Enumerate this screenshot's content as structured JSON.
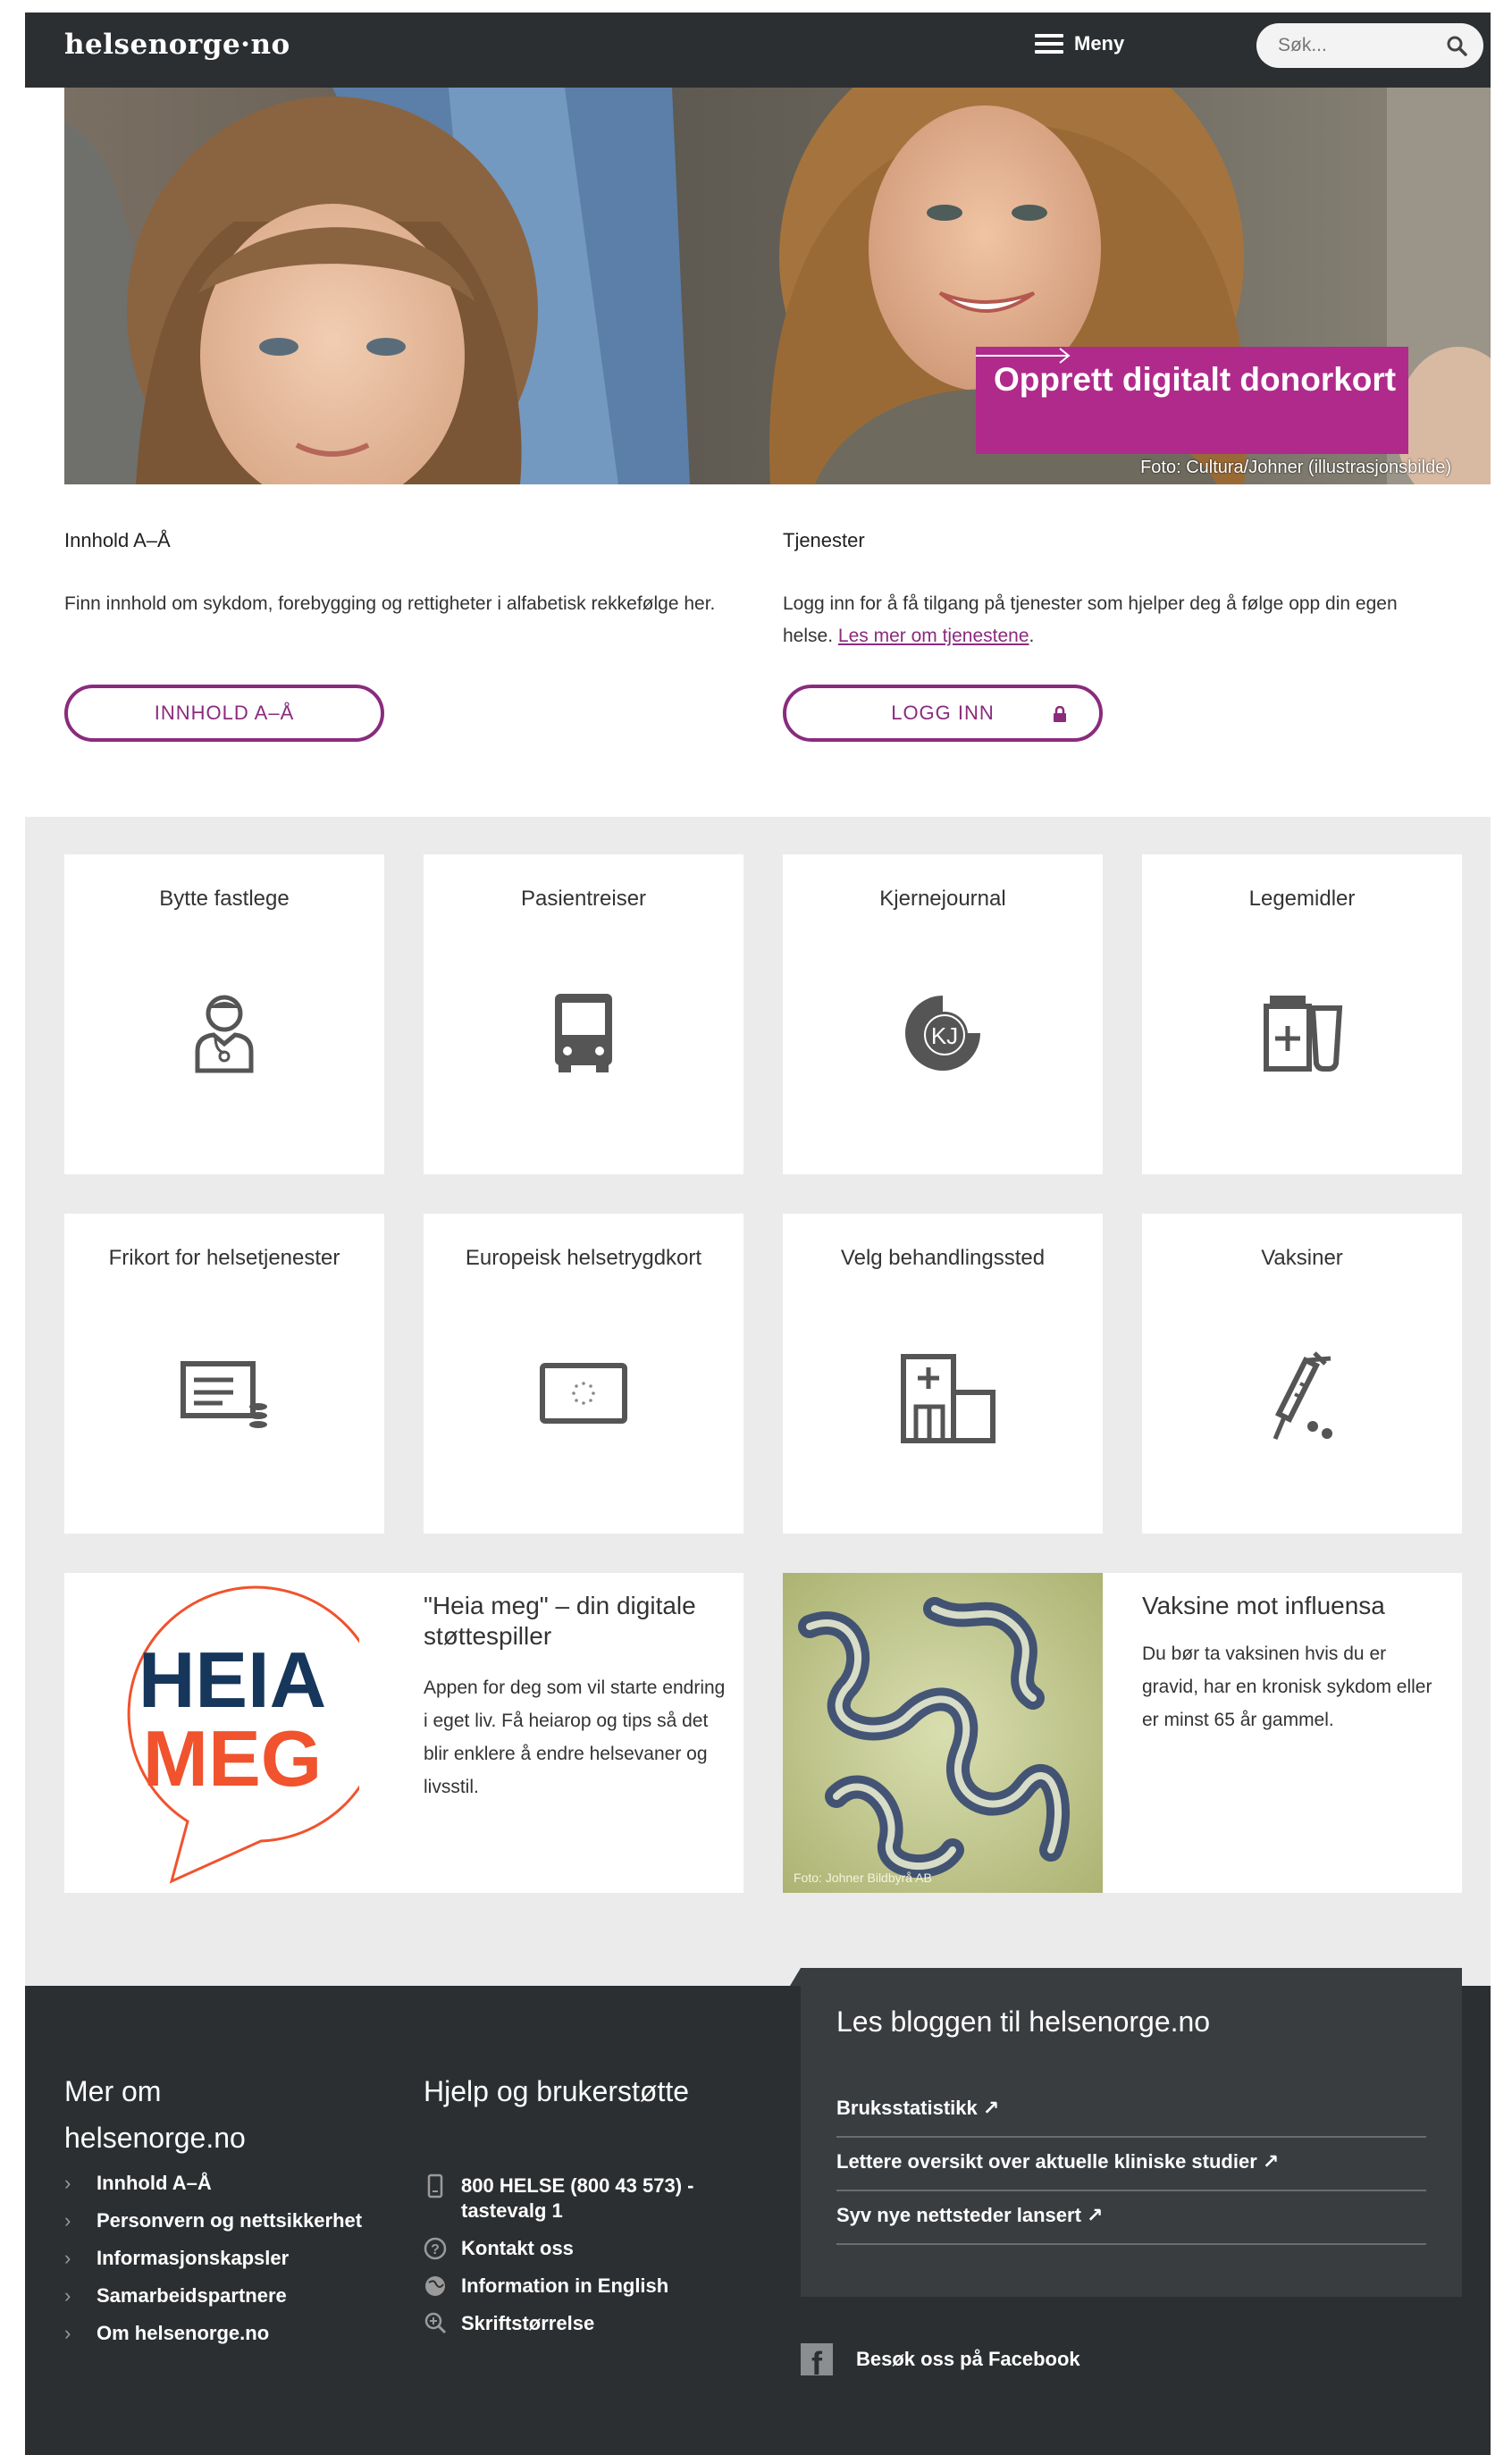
{
  "header": {
    "logo": "helsenorge·no",
    "menu_label": "Meny",
    "search_placeholder": "Søk..."
  },
  "hero": {
    "banner_title": "Opprett digitalt donorkort",
    "photo_credit": "Foto: Cultura/Johner (illustrasjonsbilde)"
  },
  "content_az": {
    "heading": "Innhold A–Å",
    "text": "Finn innhold om sykdom, forebygging og rettigheter i alfabetisk rekkefølge her.",
    "button_label": "INNHOLD A–Å"
  },
  "services": {
    "heading": "Tjenester",
    "text": "Logg inn for å få tilgang på tjenester som hjelper deg å følge opp din egen helse.",
    "link": "Les mer om tjenestene",
    "text_end": ".",
    "button_label": "LOGG INN"
  },
  "tiles": [
    {
      "label": "Bytte fastlege",
      "icon": "doctor-icon"
    },
    {
      "label": "Pasientreiser",
      "icon": "bus-icon"
    },
    {
      "label": "Kjernejournal",
      "icon": "kj-logo-icon"
    },
    {
      "label": "Legemidler",
      "icon": "medicine-icon"
    },
    {
      "label": "Frikort for helsetjenester",
      "icon": "card-coins-icon"
    },
    {
      "label": "Europeisk helsetrygdkort",
      "icon": "eu-card-icon"
    },
    {
      "label": "Velg behandlingssted",
      "icon": "hospital-icon"
    },
    {
      "label": "Vaksiner",
      "icon": "syringe-icon"
    }
  ],
  "promo_heia": {
    "logo_line1": "HEIA",
    "logo_line2": "MEG",
    "title": "\"Heia meg\" – din digitale støttespiller",
    "text": "Appen for deg som vil starte endring i eget liv. Få heiarop og tips så det blir enklere å endre helsevaner og livsstil."
  },
  "promo_flu": {
    "photo_credit": "Foto: Johner Bildbyrå AB",
    "title": "Vaksine mot influensa",
    "text": "Du bør ta vaksinen hvis du er gravid, har en kronisk sykdom eller er minst 65 år gammel."
  },
  "footer": {
    "about_heading": "Mer om helsenorge.no",
    "about_links": [
      "Innhold A–Å",
      "Personvern og nettsikkerhet",
      "Informasjonskapsler",
      "Samarbeidspartnere",
      "Om helsenorge.no"
    ],
    "help_heading": "Hjelp og brukerstøtte",
    "help_items": [
      {
        "label": "800 HELSE (800 43 573) - tastevalg 1",
        "icon": "phone-icon"
      },
      {
        "label": "Kontakt oss",
        "icon": "question-icon"
      },
      {
        "label": "Information in English",
        "icon": "globe-icon"
      },
      {
        "label": "Skriftstørrelse",
        "icon": "zoom-icon"
      }
    ],
    "blog_heading": "Les bloggen til helsenorge.no",
    "blog_links": [
      "Bruksstatistikk ↗",
      "Lettere oversikt over aktuelle kliniske studier ↗",
      "Syv nye nettsteder lansert ↗"
    ],
    "facebook_label": "Besøk oss på Facebook"
  },
  "colors": {
    "dark": "#2c2f31",
    "accent": "#8a2b7d",
    "banner": "#b02a8c",
    "grid_bg": "#ebebeb",
    "heia_navy": "#16365b",
    "heia_orange": "#f0532d"
  }
}
